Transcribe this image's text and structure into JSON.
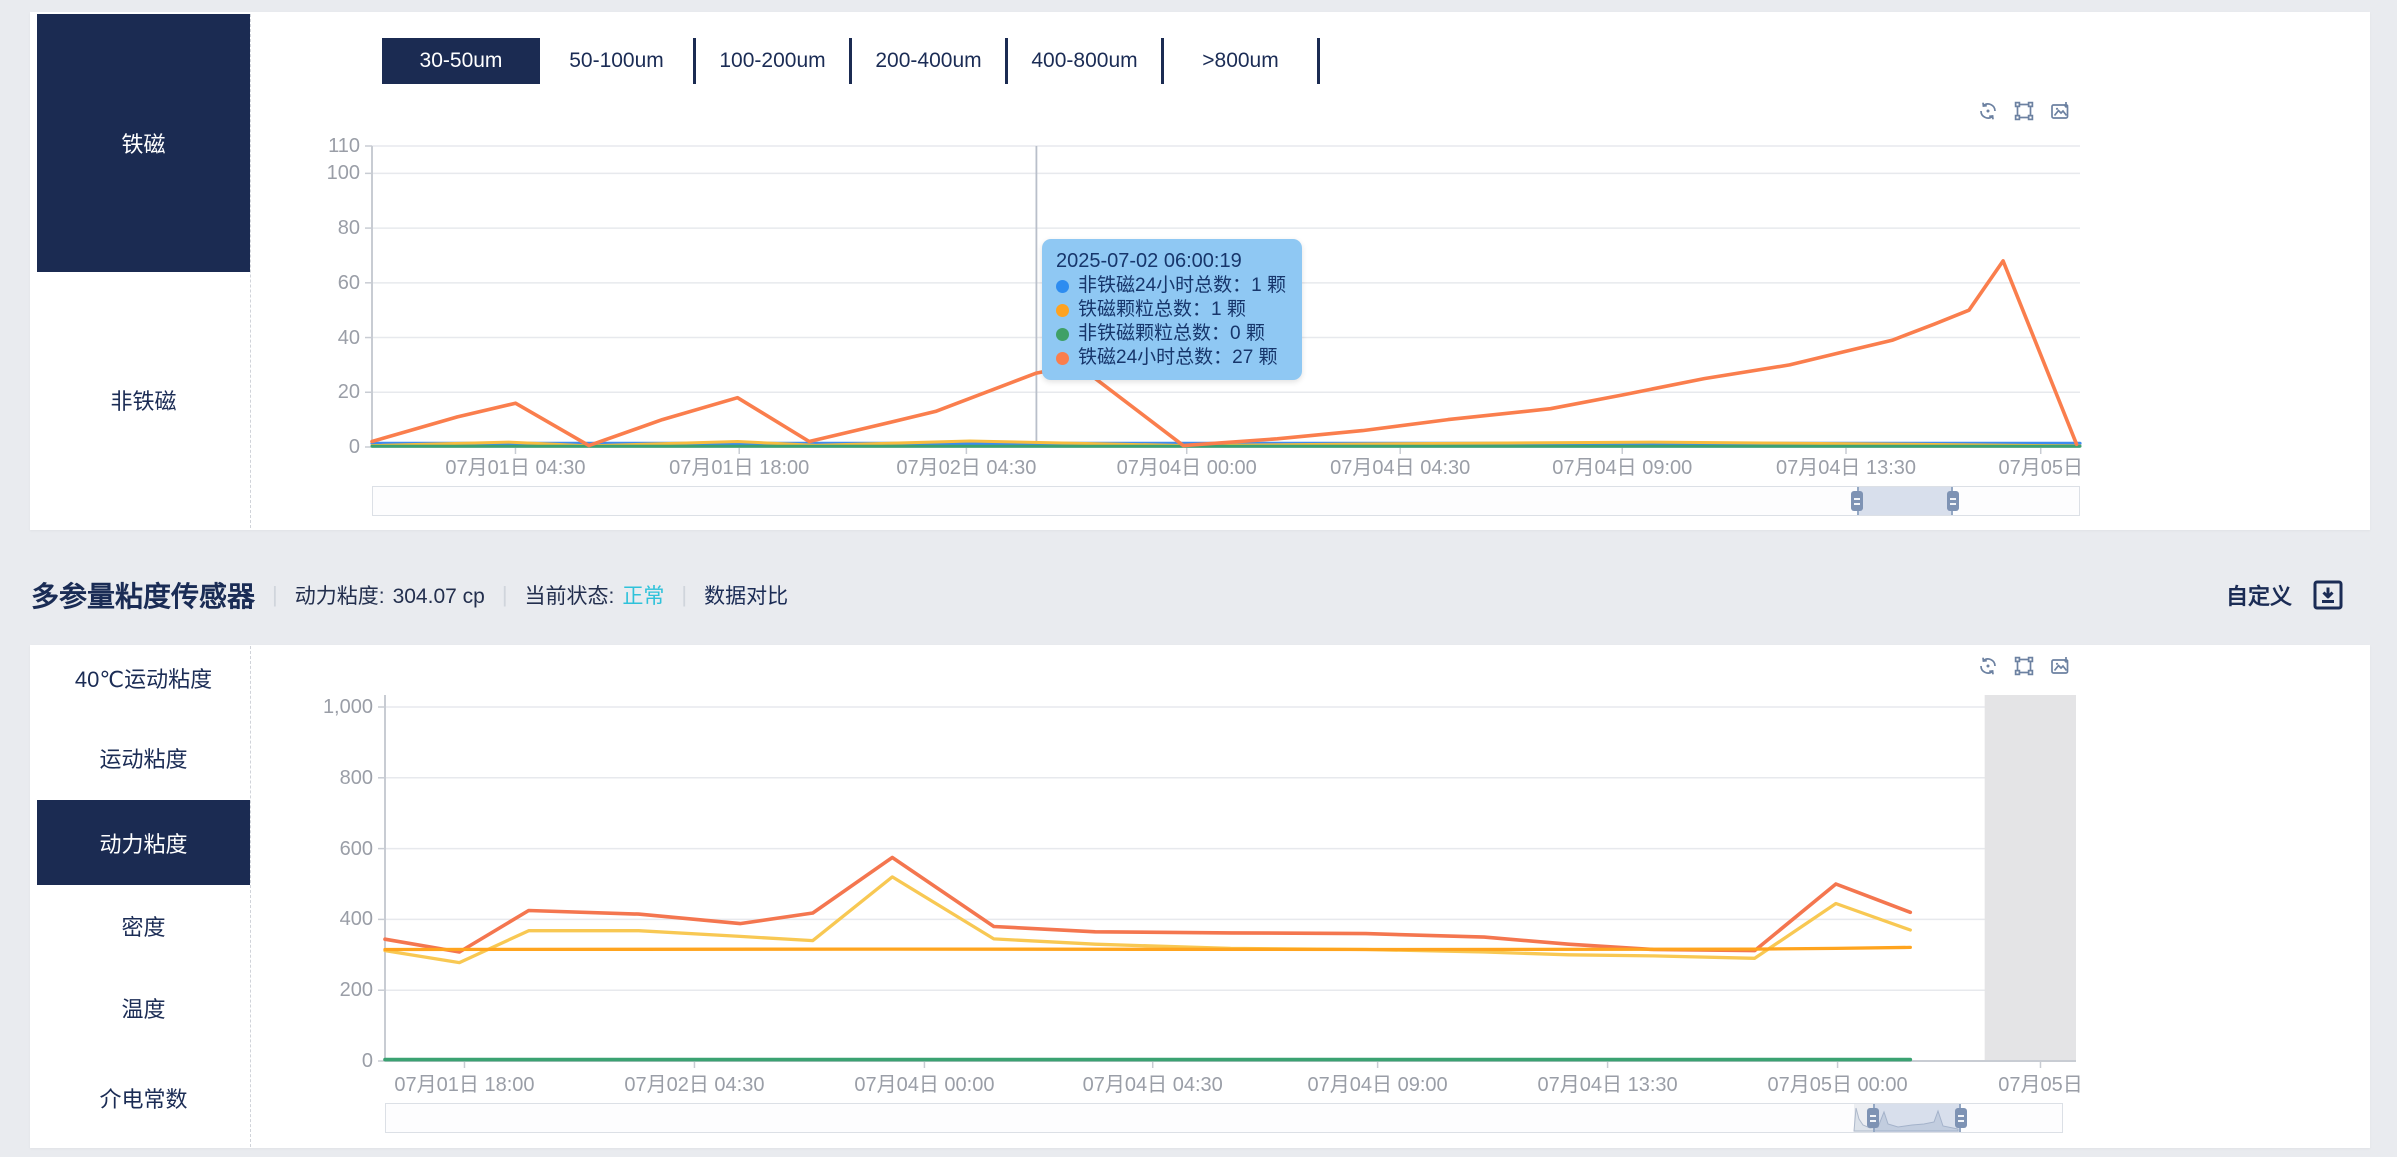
{
  "colors": {
    "accent_navy": "#1B2B52",
    "status_cyan": "#2EC2DA",
    "tooltip_bg": "#8FC8F3",
    "axis_label": "#9A9EA7"
  },
  "top_panel": {
    "sidebar_items": [
      {
        "label": "铁磁",
        "selected": true
      },
      {
        "label": "非铁磁",
        "selected": false
      }
    ],
    "tabs": [
      {
        "label": "30-50um",
        "selected": true
      },
      {
        "label": "50-100um",
        "selected": false
      },
      {
        "label": "100-200um",
        "selected": false
      },
      {
        "label": "200-400um",
        "selected": false
      },
      {
        "label": "400-800um",
        "selected": false
      },
      {
        "label": ">800um",
        "selected": false
      }
    ],
    "toolbox_icons": [
      "restore-icon",
      "box-select-icon",
      "save-image-icon"
    ],
    "tooltip": {
      "title": "2025-07-02 06:00:19",
      "items": [
        {
          "color": "#2D8CF0",
          "text": "非铁磁24小时总数：1 颗"
        },
        {
          "color": "#FFA321",
          "text": "铁磁颗粒总数：1 颗"
        },
        {
          "color": "#3FA066",
          "text": "非铁磁颗粒总数：0 颗"
        },
        {
          "color": "#FA7E4D",
          "text": "铁磁24小时总数：27 颗"
        }
      ]
    },
    "chart_data": {
      "type": "line",
      "x_tick_labels": [
        "07月01日 04:30",
        "07月01日 18:00",
        "07月02日 04:30",
        "07月04日 00:00",
        "07月04日 04:30",
        "07月04日 09:00",
        "07月04日 13:30",
        "07月05日"
      ],
      "x_tick_fractions": [
        0.084,
        0.215,
        0.348,
        0.477,
        0.602,
        0.732,
        0.863,
        0.977
      ],
      "y_tick_labels": [
        "0",
        "20",
        "40",
        "60",
        "80",
        "100",
        "110"
      ],
      "y_tick_values": [
        0,
        20,
        40,
        60,
        80,
        100,
        110
      ],
      "ylim": [
        0,
        110
      ],
      "grid": true,
      "legend_position": "none",
      "axis_pointer_fraction": 0.389,
      "series": [
        {
          "name": "非铁磁24小时总数",
          "color": "#3D8CF0",
          "width": 3.2,
          "points": [
            [
              0,
              1.3
            ],
            [
              1,
              1.3
            ]
          ]
        },
        {
          "name": "铁磁颗粒总数",
          "color": "#F7BC3F",
          "width": 3,
          "points": [
            [
              0,
              0.5
            ],
            [
              0.08,
              1.8
            ],
            [
              0.127,
              0.4
            ],
            [
              0.214,
              2
            ],
            [
              0.26,
              0.6
            ],
            [
              0.35,
              2.2
            ],
            [
              0.477,
              0.5
            ],
            [
              0.6,
              1.2
            ],
            [
              0.75,
              1.8
            ],
            [
              0.9,
              1
            ],
            [
              1,
              0.4
            ]
          ]
        },
        {
          "name": "非铁磁颗粒总数",
          "color": "#3BA272",
          "width": 3,
          "points": [
            [
              0,
              0.3
            ],
            [
              1,
              0.3
            ]
          ]
        },
        {
          "name": "铁磁24小时总数",
          "color": "#FA7E4D",
          "width": 3.6,
          "points": [
            [
              0,
              2
            ],
            [
              0.05,
              11
            ],
            [
              0.084,
              16
            ],
            [
              0.127,
              0.5
            ],
            [
              0.17,
              10
            ],
            [
              0.214,
              18
            ],
            [
              0.256,
              2
            ],
            [
              0.29,
              7
            ],
            [
              0.33,
              13
            ],
            [
              0.389,
              27
            ],
            [
              0.413,
              30
            ],
            [
              0.475,
              0.5
            ],
            [
              0.53,
              3
            ],
            [
              0.58,
              6
            ],
            [
              0.63,
              10
            ],
            [
              0.69,
              14
            ],
            [
              0.732,
              19
            ],
            [
              0.78,
              25
            ],
            [
              0.83,
              30
            ],
            [
              0.863,
              35
            ],
            [
              0.89,
              39
            ],
            [
              0.915,
              45
            ],
            [
              0.935,
              50
            ],
            [
              0.955,
              68
            ],
            [
              0.998,
              1
            ]
          ]
        }
      ]
    }
  },
  "section_header": {
    "title": "多参量粘度传感器",
    "separator": "|",
    "metric_label": "动力粘度:",
    "metric_value": "304.07 cp",
    "status_label": "当前状态:",
    "status_value": "正常",
    "compare_label": "数据对比",
    "custom_label": "自定义"
  },
  "bottom_panel": {
    "sidebar_items": [
      {
        "label": "40℃运动粘度",
        "selected": false
      },
      {
        "label": "运动粘度",
        "selected": false
      },
      {
        "label": "动力粘度",
        "selected": true
      },
      {
        "label": "密度",
        "selected": false
      },
      {
        "label": "温度",
        "selected": false
      },
      {
        "label": "介电常数",
        "selected": false
      }
    ],
    "toolbox_icons": [
      "restore-icon",
      "box-select-icon",
      "save-image-icon"
    ],
    "chart_data": {
      "type": "line",
      "x_tick_labels": [
        "07月01日 18:00",
        "07月02日 04:30",
        "07月04日 00:00",
        "07月04日 04:30",
        "07月04日 09:00",
        "07月04日 13:30",
        "07月05日 00:00",
        "07月05日"
      ],
      "x_tick_fractions": [
        0.047,
        0.183,
        0.319,
        0.454,
        0.587,
        0.723,
        0.859,
        0.979
      ],
      "y_tick_labels": [
        "0",
        "200",
        "400",
        "600",
        "800",
        "1,000"
      ],
      "y_tick_values": [
        0,
        200,
        400,
        600,
        800,
        1000
      ],
      "ylim": [
        0,
        1000
      ],
      "grid": true,
      "legend_position": "none",
      "no_data_band_fractions": [
        0.946,
        1.0
      ],
      "series": [
        {
          "name": "line-red-orange",
          "color": "#F4764F",
          "width": 3.6,
          "points": [
            [
              0,
              344
            ],
            [
              0.044,
              308
            ],
            [
              0.085,
              425
            ],
            [
              0.15,
              415
            ],
            [
              0.21,
              388
            ],
            [
              0.253,
              418
            ],
            [
              0.3,
              575
            ],
            [
              0.36,
              380
            ],
            [
              0.42,
              365
            ],
            [
              0.5,
              362
            ],
            [
              0.58,
              360
            ],
            [
              0.65,
              350
            ],
            [
              0.7,
              330
            ],
            [
              0.75,
              315
            ],
            [
              0.81,
              312
            ],
            [
              0.858,
              500
            ],
            [
              0.902,
              420
            ]
          ]
        },
        {
          "name": "line-yellow",
          "color": "#F8C853",
          "width": 3.3,
          "points": [
            [
              0,
              312
            ],
            [
              0.044,
              278
            ],
            [
              0.085,
              368
            ],
            [
              0.15,
              368
            ],
            [
              0.21,
              352
            ],
            [
              0.253,
              340
            ],
            [
              0.3,
              520
            ],
            [
              0.36,
              345
            ],
            [
              0.42,
              330
            ],
            [
              0.5,
              318
            ],
            [
              0.58,
              315
            ],
            [
              0.65,
              308
            ],
            [
              0.7,
              300
            ],
            [
              0.75,
              297
            ],
            [
              0.81,
              290
            ],
            [
              0.858,
              445
            ],
            [
              0.902,
              370
            ]
          ]
        },
        {
          "name": "line-orange-flat",
          "color": "#FFA41E",
          "width": 3.3,
          "points": [
            [
              0,
              315
            ],
            [
              0.3,
              316
            ],
            [
              0.6,
              315
            ],
            [
              0.81,
              316
            ],
            [
              0.858,
              318
            ],
            [
              0.902,
              321
            ]
          ]
        },
        {
          "name": "line-green-baseline",
          "color": "#3BA272",
          "width": 3.6,
          "points": [
            [
              0,
              4
            ],
            [
              0.902,
              4
            ]
          ]
        }
      ]
    }
  }
}
